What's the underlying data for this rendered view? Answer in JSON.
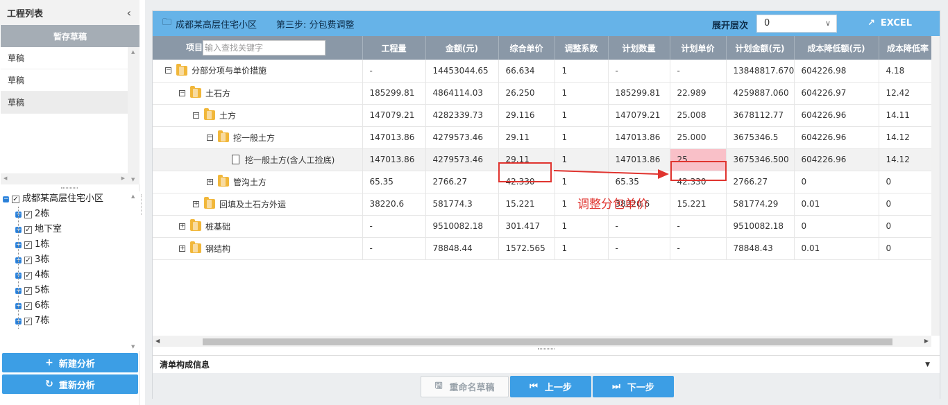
{
  "sidebar": {
    "title": "工程列表",
    "collapse_icon": "chevron-left-icon",
    "drafts_header": "暂存草稿",
    "drafts": [
      "草稿",
      "草稿",
      "草稿"
    ],
    "tree": {
      "root": "成都某高层住宅小区",
      "children": [
        "2栋",
        "地下室",
        "1栋",
        "3栋",
        "4栋",
        "5栋",
        "6栋",
        "7栋"
      ]
    },
    "new_button": "新建分析",
    "reanalyze_button": "重新分析"
  },
  "header": {
    "project": "成都某高层住宅小区",
    "step": "第三步: 分包费调整",
    "level_label": "展开层次",
    "level_value": "0",
    "excel_label": "EXCEL"
  },
  "table": {
    "columns": [
      "项目",
      "工程量",
      "金额(元)",
      "综合单价",
      "调整系数",
      "计划数量",
      "计划单价",
      "计划金额(元)",
      "成本降低额(元)",
      "成本降低率"
    ],
    "search_placeholder": "输入查找关键字",
    "rows": [
      {
        "name": "分部分项与单价措施",
        "qty": "-",
        "amount": "14453044.65",
        "unit_price": "66.634",
        "coef": "1",
        "plan_qty": "-",
        "plan_price": "-",
        "plan_amount": "13848817.670",
        "reduce": "604226.98",
        "rate": "4.18"
      },
      {
        "name": "土石方",
        "qty": "185299.81",
        "amount": "4864114.03",
        "unit_price": "26.250",
        "coef": "1",
        "plan_qty": "185299.81",
        "plan_price": "22.989",
        "plan_amount": "4259887.060",
        "reduce": "604226.97",
        "rate": "12.42"
      },
      {
        "name": "土方",
        "qty": "147079.21",
        "amount": "4282339.73",
        "unit_price": "29.116",
        "coef": "1",
        "plan_qty": "147079.21",
        "plan_price": "25.008",
        "plan_amount": "3678112.77",
        "reduce": "604226.96",
        "rate": "14.11"
      },
      {
        "name": "挖一般土方",
        "qty": "147013.86",
        "amount": "4279573.46",
        "unit_price": "29.11",
        "coef": "1",
        "plan_qty": "147013.86",
        "plan_price": "25.000",
        "plan_amount": "3675346.5",
        "reduce": "604226.96",
        "rate": "14.12"
      },
      {
        "name": "挖一般土方(含人工捡底)",
        "qty": "147013.86",
        "amount": "4279573.46",
        "unit_price": "29.11",
        "coef": "1",
        "plan_qty": "147013.86",
        "plan_price": "25",
        "plan_amount": "3675346.500",
        "reduce": "604226.96",
        "rate": "14.12"
      },
      {
        "name": "管沟土方",
        "qty": "65.35",
        "amount": "2766.27",
        "unit_price": "42.330",
        "coef": "1",
        "plan_qty": "65.35",
        "plan_price": "42.330",
        "plan_amount": "2766.27",
        "reduce": "0",
        "rate": "0"
      },
      {
        "name": "回填及土石方外运",
        "qty": "38220.6",
        "amount": "581774.3",
        "unit_price": "15.221",
        "coef": "1",
        "plan_qty": "38220.6",
        "plan_price": "15.221",
        "plan_amount": "581774.29",
        "reduce": "0.01",
        "rate": "0"
      },
      {
        "name": "桩基础",
        "qty": "-",
        "amount": "9510082.18",
        "unit_price": "301.417",
        "coef": "1",
        "plan_qty": "-",
        "plan_price": "-",
        "plan_amount": "9510082.18",
        "reduce": "0",
        "rate": "0"
      },
      {
        "name": "钢结构",
        "qty": "-",
        "amount": "78848.44",
        "unit_price": "1572.565",
        "coef": "1",
        "plan_qty": "-",
        "plan_price": "-",
        "plan_amount": "78848.43",
        "reduce": "0.01",
        "rate": "0"
      }
    ]
  },
  "annotation": "调整分包单价",
  "detail_title": "清单构成信息",
  "footer": {
    "rename": "重命名草稿",
    "prev": "上一步",
    "next": "下一步"
  },
  "colors": {
    "header_blue": "#66b3e8",
    "button_blue": "#3c9ee5",
    "table_header": "#8a98a7",
    "annotation_red": "#e0342f",
    "highlight_pink": "#f9c0c8"
  }
}
